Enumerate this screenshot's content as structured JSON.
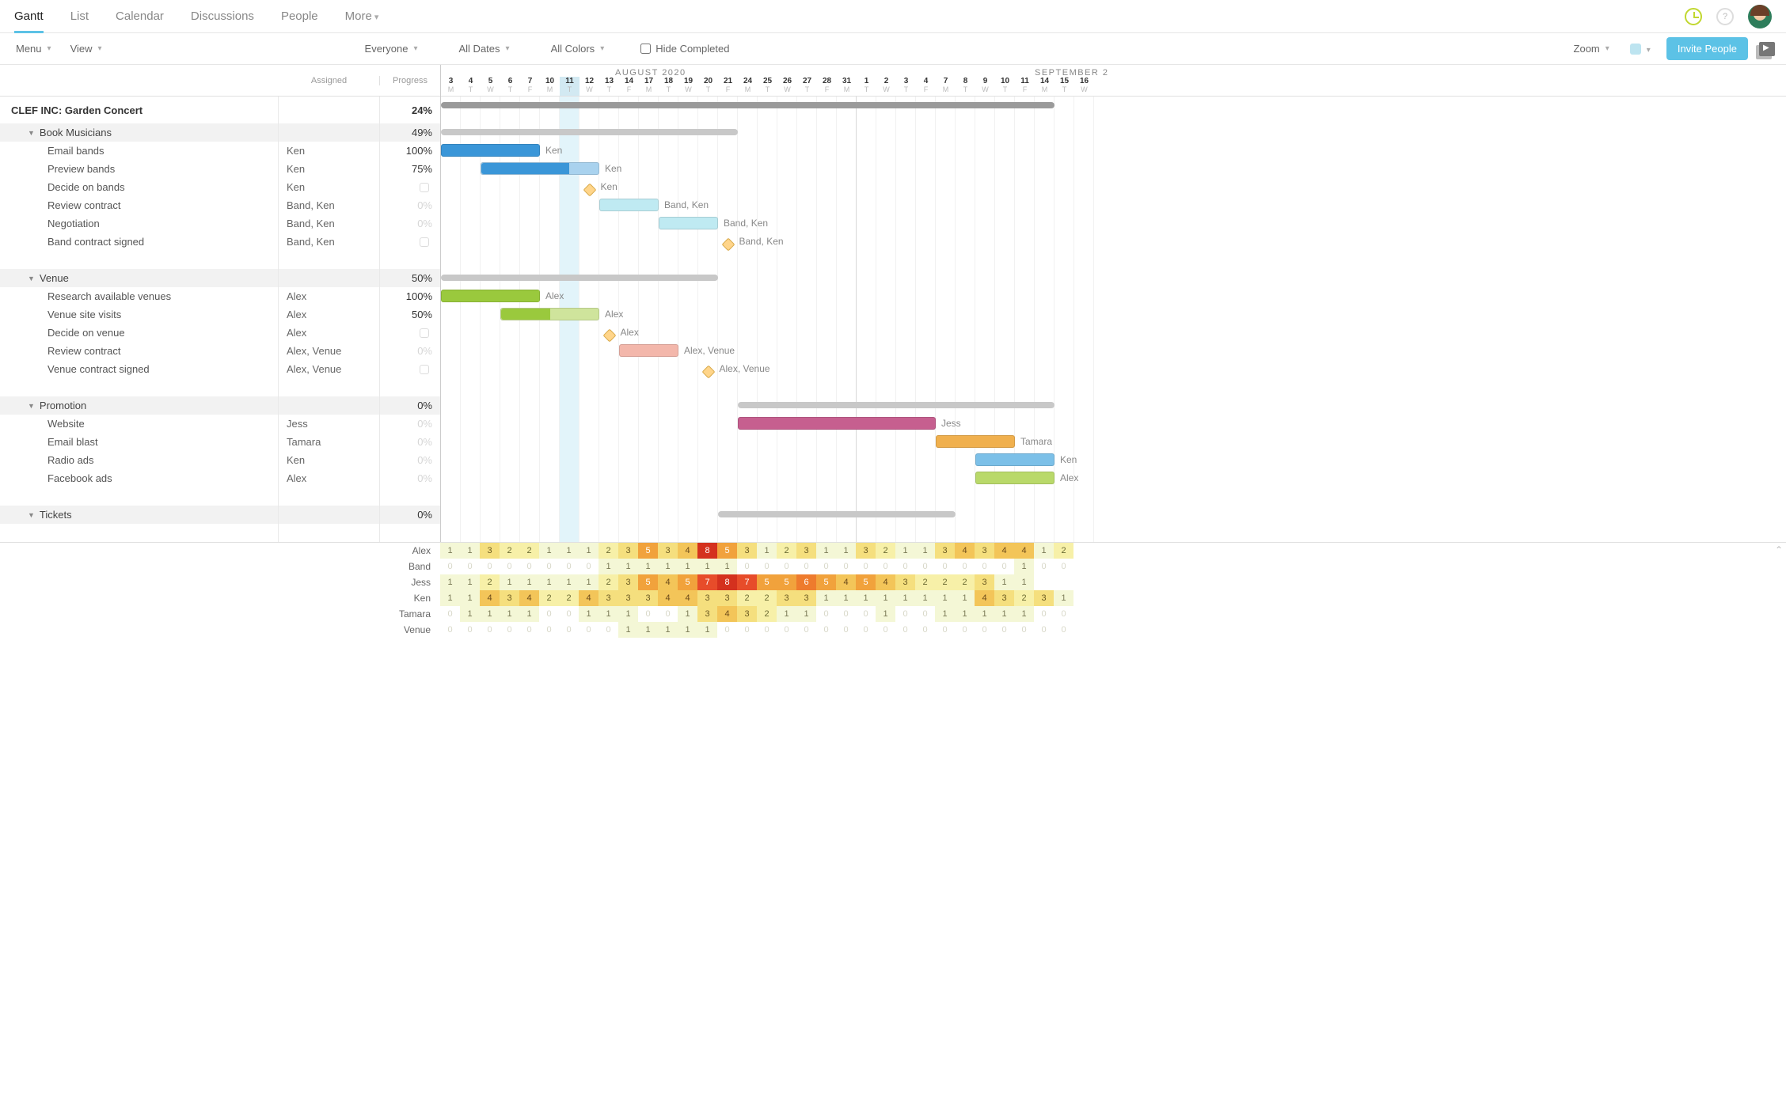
{
  "nav": {
    "tabs": [
      "Gantt",
      "List",
      "Calendar",
      "Discussions",
      "People",
      "More"
    ],
    "active": "Gantt"
  },
  "toolbar": {
    "menu": "Menu",
    "view": "View",
    "everyone": "Everyone",
    "all_dates": "All Dates",
    "all_colors": "All Colors",
    "hide_completed": "Hide Completed",
    "zoom": "Zoom",
    "invite": "Invite People"
  },
  "columns": {
    "assigned": "Assigned",
    "progress": "Progress"
  },
  "months": {
    "aug": "AUGUST 2020",
    "sep": "SEPTEMBER 2"
  },
  "days": [
    {
      "n": "3",
      "l": "M"
    },
    {
      "n": "4",
      "l": "T"
    },
    {
      "n": "5",
      "l": "W"
    },
    {
      "n": "6",
      "l": "T"
    },
    {
      "n": "7",
      "l": "F"
    },
    {
      "n": "10",
      "l": "M"
    },
    {
      "n": "11",
      "l": "T",
      "today": true
    },
    {
      "n": "12",
      "l": "W"
    },
    {
      "n": "13",
      "l": "T"
    },
    {
      "n": "14",
      "l": "F"
    },
    {
      "n": "17",
      "l": "M"
    },
    {
      "n": "18",
      "l": "T"
    },
    {
      "n": "19",
      "l": "W"
    },
    {
      "n": "20",
      "l": "T"
    },
    {
      "n": "21",
      "l": "F"
    },
    {
      "n": "24",
      "l": "M"
    },
    {
      "n": "25",
      "l": "T"
    },
    {
      "n": "26",
      "l": "W"
    },
    {
      "n": "27",
      "l": "T"
    },
    {
      "n": "28",
      "l": "F"
    },
    {
      "n": "31",
      "l": "M"
    },
    {
      "n": "1",
      "l": "T"
    },
    {
      "n": "2",
      "l": "W"
    },
    {
      "n": "3",
      "l": "T"
    },
    {
      "n": "4",
      "l": "F"
    },
    {
      "n": "7",
      "l": "M"
    },
    {
      "n": "8",
      "l": "T"
    },
    {
      "n": "9",
      "l": "W"
    },
    {
      "n": "10",
      "l": "T"
    },
    {
      "n": "11",
      "l": "F"
    },
    {
      "n": "14",
      "l": "M"
    },
    {
      "n": "15",
      "l": "T"
    },
    {
      "n": "16",
      "l": "W"
    }
  ],
  "project": {
    "name": "CLEF INC: Garden Concert",
    "progress": "24%"
  },
  "groups": [
    {
      "name": "Book Musicians",
      "progress": "49%",
      "tasks": [
        {
          "name": "Email bands",
          "assigned": "Ken",
          "progress": "100%",
          "bar": {
            "start": 0,
            "len": 5,
            "color": "#3a96d8",
            "fill": 100,
            "label": "Ken"
          }
        },
        {
          "name": "Preview bands",
          "assigned": "Ken",
          "progress": "75%",
          "bar": {
            "start": 2,
            "len": 6,
            "color": "#3a96d8",
            "light": "#a9d2ee",
            "fill": 75,
            "label": "Ken"
          }
        },
        {
          "name": "Decide on bands",
          "assigned": "Ken",
          "progress": "",
          "milestone": {
            "at": 7.5,
            "label": "Ken"
          }
        },
        {
          "name": "Review contract",
          "assigned": "Band, Ken",
          "progress": "0%",
          "bar": {
            "start": 8,
            "len": 3,
            "color": "#bfeaf2",
            "label": "Band, Ken"
          }
        },
        {
          "name": "Negotiation",
          "assigned": "Band, Ken",
          "progress": "0%",
          "bar": {
            "start": 11,
            "len": 3,
            "color": "#bfeaf2",
            "label": "Band, Ken"
          }
        },
        {
          "name": "Band contract signed",
          "assigned": "Band, Ken",
          "progress": "",
          "milestone": {
            "at": 14.5,
            "label": "Band, Ken"
          }
        }
      ],
      "summary": {
        "start": 0,
        "len": 15
      }
    },
    {
      "name": "Venue",
      "progress": "50%",
      "tasks": [
        {
          "name": "Research available venues",
          "assigned": "Alex",
          "progress": "100%",
          "bar": {
            "start": 0,
            "len": 5,
            "color": "#9ac93d",
            "fill": 100,
            "label": "Alex"
          }
        },
        {
          "name": "Venue site visits",
          "assigned": "Alex",
          "progress": "50%",
          "bar": {
            "start": 3,
            "len": 5,
            "color": "#9ac93d",
            "light": "#cfe49c",
            "fill": 50,
            "label": "Alex"
          }
        },
        {
          "name": "Decide on venue",
          "assigned": "Alex",
          "progress": "",
          "milestone": {
            "at": 8.5,
            "label": "Alex"
          }
        },
        {
          "name": "Review contract",
          "assigned": "Alex, Venue",
          "progress": "0%",
          "bar": {
            "start": 9,
            "len": 3,
            "color": "#f3b7ab",
            "label": "Alex, Venue"
          }
        },
        {
          "name": "Venue contract signed",
          "assigned": "Alex, Venue",
          "progress": "",
          "milestone": {
            "at": 13.5,
            "label": "Alex, Venue"
          }
        }
      ],
      "summary": {
        "start": 0,
        "len": 14
      }
    },
    {
      "name": "Promotion",
      "progress": "0%",
      "tasks": [
        {
          "name": "Website",
          "assigned": "Jess",
          "progress": "0%",
          "bar": {
            "start": 15,
            "len": 10,
            "color": "#c65f8f",
            "label": "Jess"
          }
        },
        {
          "name": "Email blast",
          "assigned": "Tamara",
          "progress": "0%",
          "bar": {
            "start": 25,
            "len": 4,
            "color": "#f0b04e",
            "label": "Tamara"
          }
        },
        {
          "name": "Radio ads",
          "assigned": "Ken",
          "progress": "0%",
          "bar": {
            "start": 27,
            "len": 4,
            "color": "#7cc0e8",
            "label": "Ken"
          }
        },
        {
          "name": "Facebook ads",
          "assigned": "Alex",
          "progress": "0%",
          "bar": {
            "start": 27,
            "len": 4,
            "color": "#b9d96a",
            "label": "Alex"
          }
        }
      ],
      "summary": {
        "start": 15,
        "len": 16
      }
    },
    {
      "name": "Tickets",
      "progress": "0%",
      "tasks": [],
      "summary": {
        "start": 14,
        "len": 12
      }
    }
  ],
  "workload": {
    "people": [
      "Alex",
      "Band",
      "Jess",
      "Ken",
      "Tamara",
      "Venue"
    ],
    "rows": [
      [
        1,
        1,
        3,
        2,
        2,
        1,
        1,
        1,
        2,
        3,
        5,
        3,
        4,
        8,
        5,
        3,
        1,
        2,
        3,
        1,
        1,
        3,
        2,
        1,
        1,
        3,
        4,
        3,
        4,
        4,
        1,
        2,
        null
      ],
      [
        0,
        0,
        0,
        0,
        0,
        0,
        0,
        0,
        1,
        1,
        1,
        1,
        1,
        1,
        1,
        0,
        0,
        0,
        0,
        0,
        0,
        0,
        0,
        0,
        0,
        0,
        0,
        0,
        0,
        1,
        0,
        0,
        null
      ],
      [
        1,
        1,
        2,
        1,
        1,
        1,
        1,
        1,
        2,
        3,
        5,
        4,
        5,
        7,
        8,
        7,
        5,
        5,
        6,
        5,
        4,
        5,
        4,
        3,
        2,
        2,
        2,
        3,
        1,
        1,
        null,
        null,
        null
      ],
      [
        1,
        1,
        4,
        3,
        4,
        2,
        2,
        4,
        3,
        3,
        3,
        4,
        4,
        3,
        3,
        2,
        2,
        3,
        3,
        1,
        1,
        1,
        1,
        1,
        1,
        1,
        1,
        4,
        3,
        2,
        3,
        1,
        null
      ],
      [
        0,
        1,
        1,
        1,
        1,
        0,
        0,
        1,
        1,
        1,
        0,
        0,
        1,
        3,
        4,
        3,
        2,
        1,
        1,
        0,
        0,
        0,
        1,
        0,
        0,
        1,
        1,
        1,
        1,
        1,
        0,
        0,
        null
      ],
      [
        0,
        0,
        0,
        0,
        0,
        0,
        0,
        0,
        0,
        1,
        1,
        1,
        1,
        1,
        0,
        0,
        0,
        0,
        0,
        0,
        0,
        0,
        0,
        0,
        0,
        0,
        0,
        0,
        0,
        0,
        0,
        0,
        null
      ]
    ]
  }
}
